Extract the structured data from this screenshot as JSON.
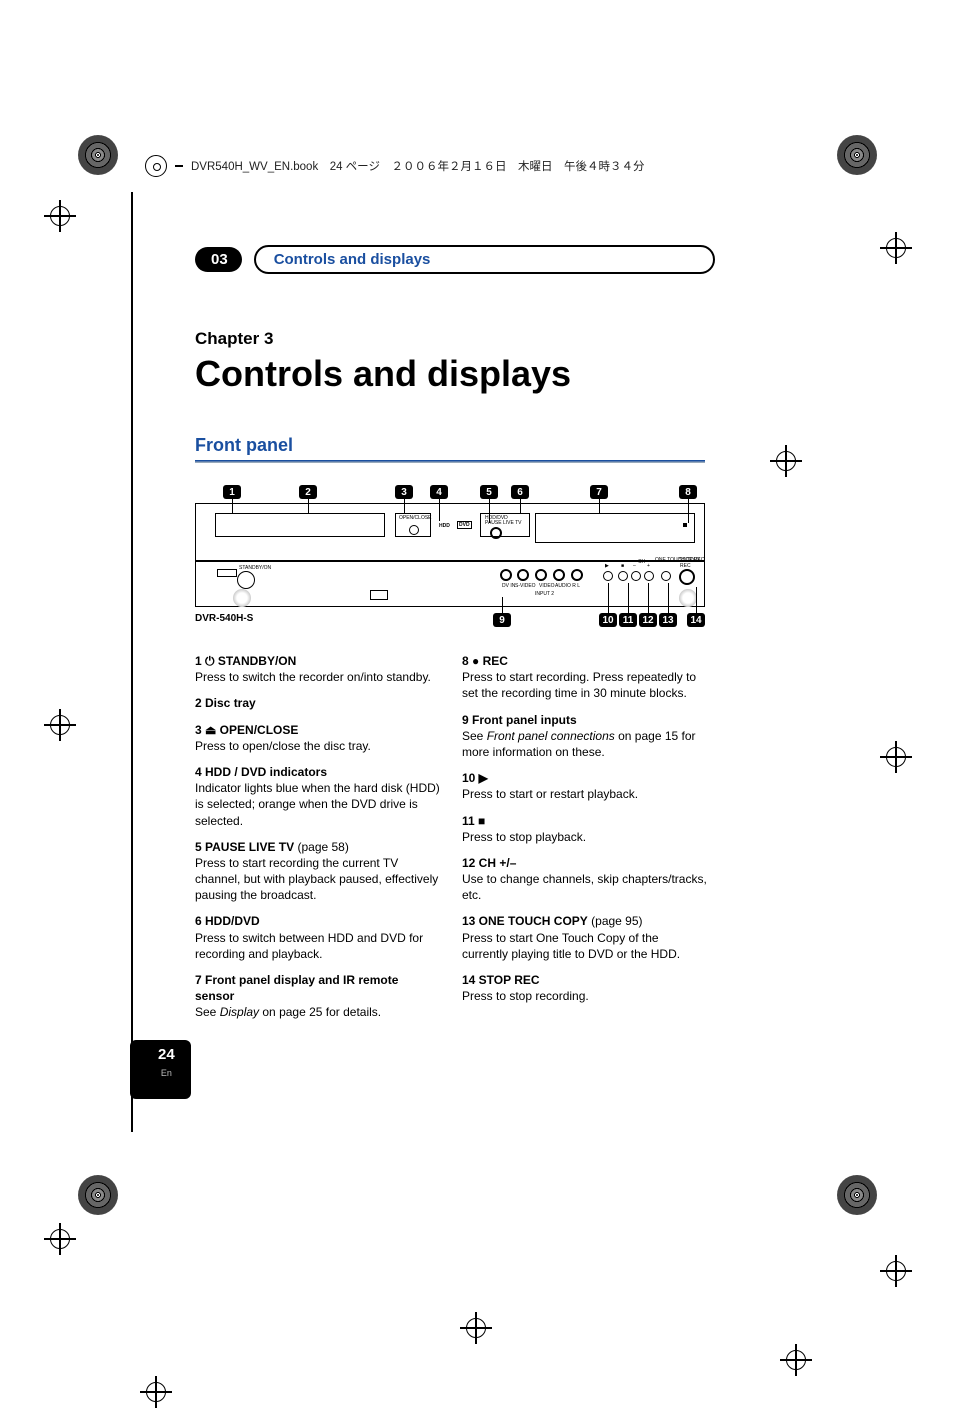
{
  "header": {
    "text": "DVR540H_WV_EN.book　24 ページ　２００６年２月１６日　木曜日　午後４時３４分"
  },
  "section": {
    "number": "03",
    "label": "Controls and displays"
  },
  "chapter": {
    "label": "Chapter 3",
    "title": "Controls and displays"
  },
  "front_panel": {
    "heading": "Front panel",
    "model": "DVR-540H-S",
    "callouts": [
      "1",
      "2",
      "3",
      "4",
      "5",
      "6",
      "7",
      "8",
      "9",
      "10",
      "11",
      "12",
      "13",
      "14"
    ],
    "panel_text": {
      "open_close": "OPEN/CLOSE",
      "hdd": "HDD",
      "dvd": "DVD",
      "standby": "STANDBY/ON",
      "hdd_dvd": "HDD/DVD",
      "pause": "PAUSE LIVE TV",
      "one_touch": "ONE TOUCH COPY",
      "stop_rec": "STOP REC",
      "rec": "REC",
      "dv": "DV IN",
      "svideo": "S-VIDEO",
      "video": "VIDEO",
      "audio": "AUDIO R L",
      "input2": "INPUT 2",
      "ch": "CH"
    }
  },
  "left_items": [
    {
      "head": "1  ⏻ STANDBY/ON",
      "body": "Press to switch the recorder on/into standby."
    },
    {
      "head": "2  Disc tray",
      "body": ""
    },
    {
      "head": "3  ⏏ OPEN/CLOSE",
      "body": "Press to open/close the disc tray."
    },
    {
      "head": "4  HDD / DVD indicators",
      "body": "Indicator lights blue when the hard disk (HDD) is selected; orange when the DVD drive is selected."
    },
    {
      "head": "5  PAUSE LIVE TV",
      "page": "(page 58)",
      "body": "Press to start recording the current TV channel, but with playback paused, effectively pausing the broadcast."
    },
    {
      "head": "6  HDD/DVD",
      "body": "Press to switch between HDD and DVD for recording and playback."
    },
    {
      "head": "7  Front panel display and IR remote sensor",
      "body_prefix": "See ",
      "body_ital": "Display",
      "body_suffix": " on page 25 for details."
    }
  ],
  "right_items": [
    {
      "head": "8  ● REC",
      "body": "Press to start recording. Press repeatedly to set the recording time in 30 minute blocks."
    },
    {
      "head": "9  Front panel inputs",
      "body_prefix": "See ",
      "body_ital": "Front panel connections",
      "body_suffix": " on page 15 for more information on these."
    },
    {
      "head": "10  ▶",
      "body": "Press to start or restart playback."
    },
    {
      "head": "11  ■",
      "body": "Press to stop playback."
    },
    {
      "head": "12  CH +/–",
      "body": "Use to change channels, skip chapters/tracks, etc."
    },
    {
      "head": "13  ONE TOUCH COPY",
      "page": "(page 95)",
      "body": "Press to start One Touch Copy of the currently playing title to DVD or the HDD."
    },
    {
      "head": "14  STOP REC",
      "body": "Press to stop recording."
    }
  ],
  "page_number": {
    "num": "24",
    "lang": "En"
  }
}
